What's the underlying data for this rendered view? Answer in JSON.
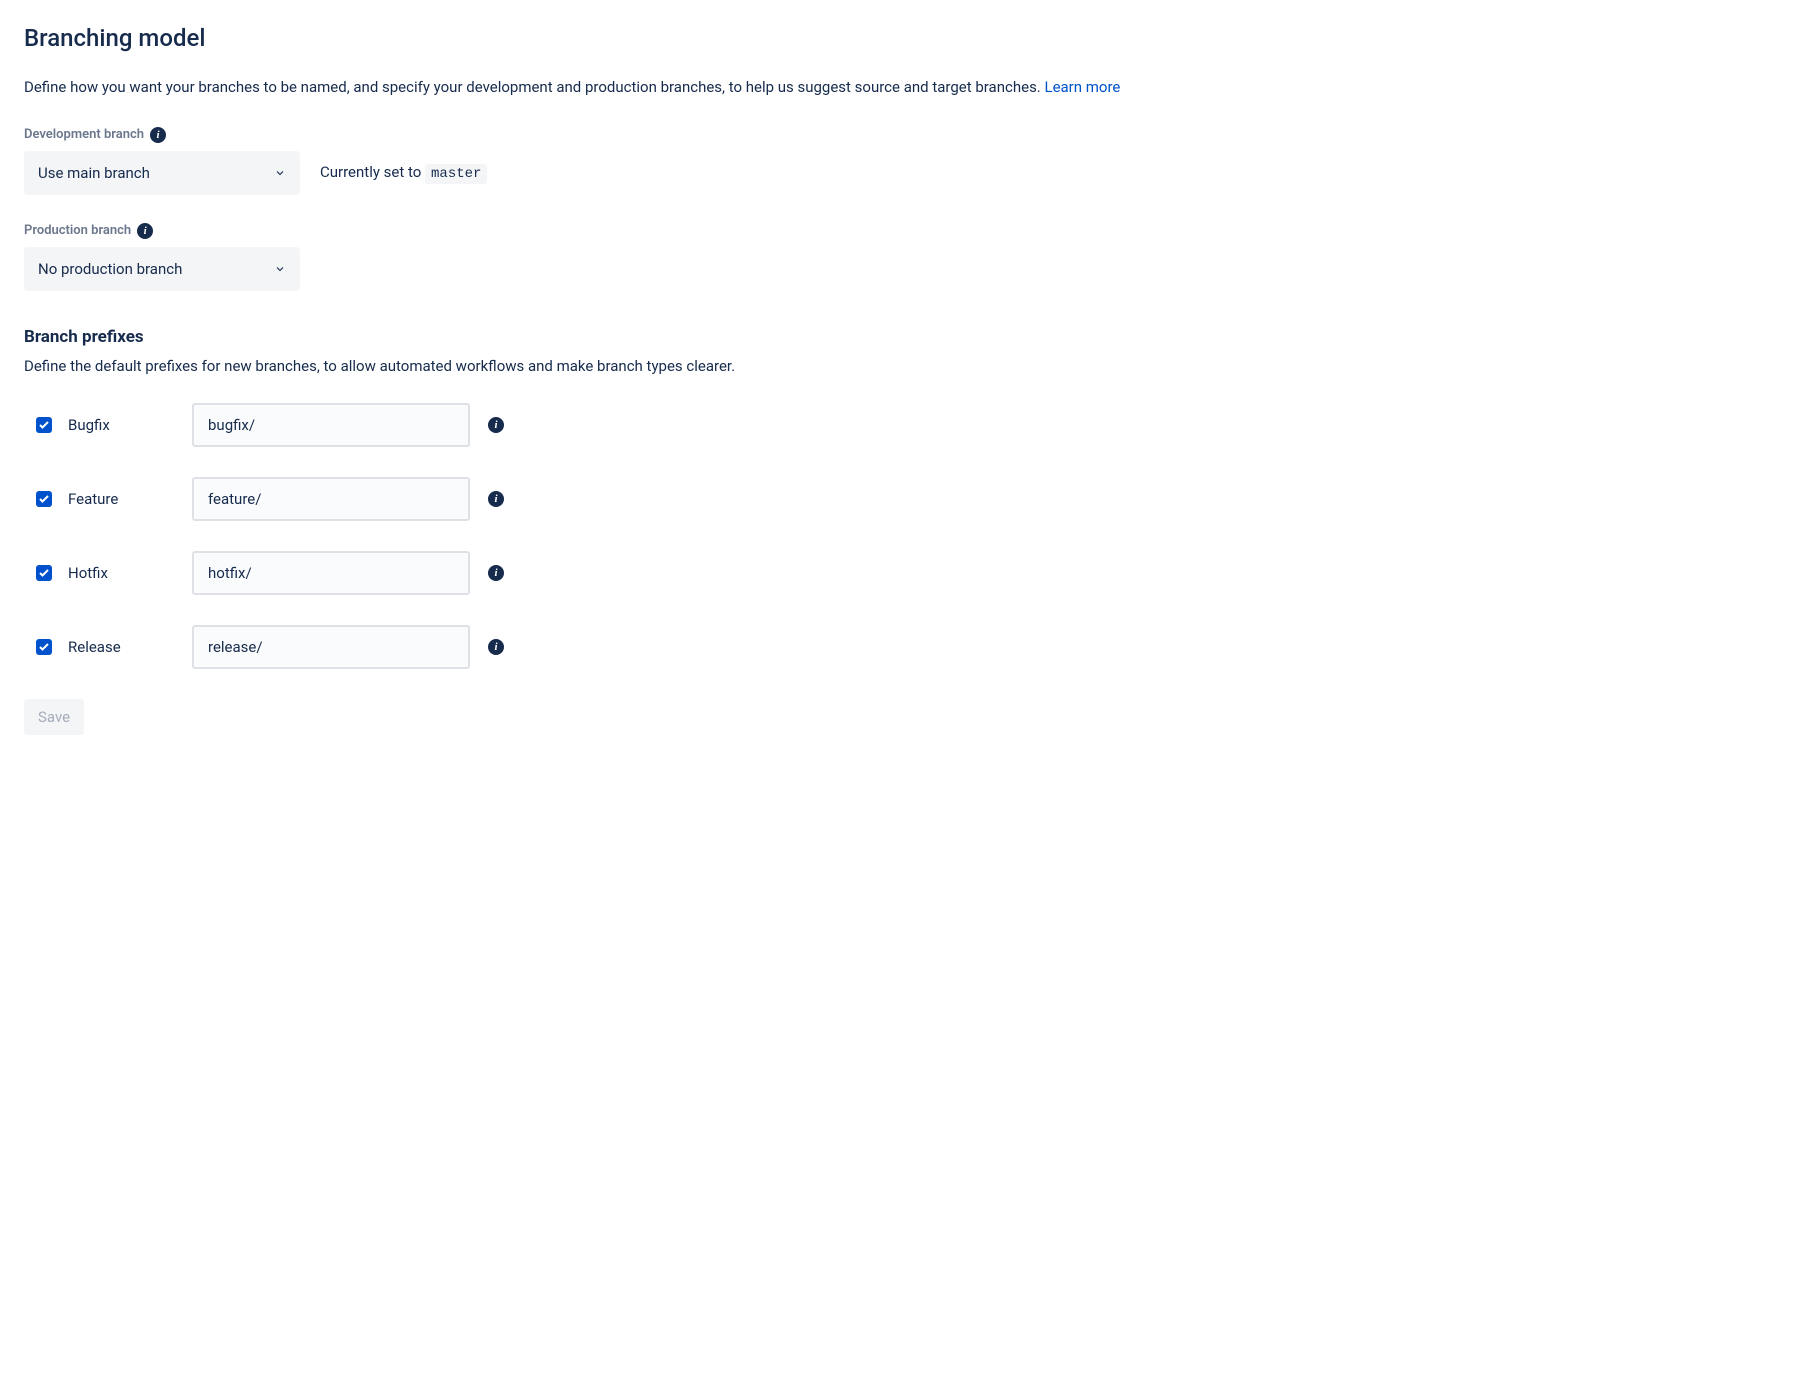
{
  "page_title": "Branching model",
  "description_prefix": "Define how you want your branches to be named, and specify your development and production branches, to help us suggest source and target branches. ",
  "learn_more": "Learn more",
  "dev_branch": {
    "label": "Development branch",
    "selected": "Use main branch",
    "currently_prefix": "Currently set to ",
    "currently_value": "master"
  },
  "prod_branch": {
    "label": "Production branch",
    "selected": "No production branch"
  },
  "prefixes": {
    "heading": "Branch prefixes",
    "description": "Define the default prefixes for new branches, to allow automated workflows and make branch types clearer.",
    "rows": [
      {
        "label": "Bugfix",
        "value": "bugfix/",
        "checked": true
      },
      {
        "label": "Feature",
        "value": "feature/",
        "checked": true
      },
      {
        "label": "Hotfix",
        "value": "hotfix/",
        "checked": true
      },
      {
        "label": "Release",
        "value": "release/",
        "checked": true
      }
    ]
  },
  "save_label": "Save"
}
